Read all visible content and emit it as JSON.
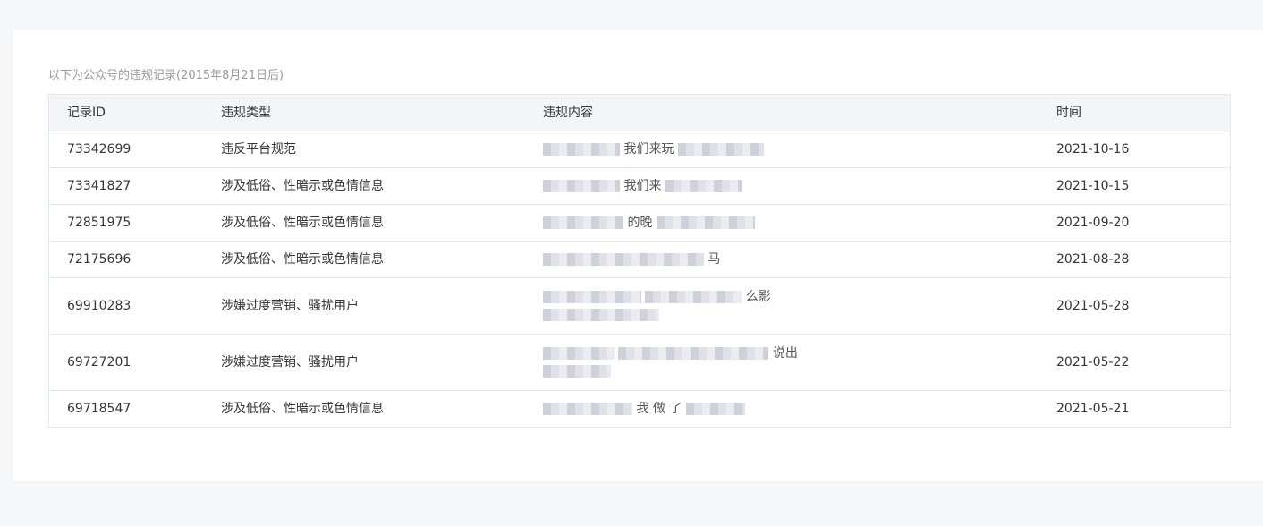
{
  "caption": "以下为公众号的违规记录(2015年8月21日后)",
  "headers": {
    "id": "记录ID",
    "type": "违规类型",
    "content": "违规内容",
    "time": "时间"
  },
  "rows": [
    {
      "id": "73342699",
      "type": "违反平台规范",
      "content": "我们来玩",
      "time": "2021-10-16"
    },
    {
      "id": "73341827",
      "type": "涉及低俗、性暗示或色情信息",
      "content": "我们来",
      "time": "2021-10-15"
    },
    {
      "id": "72851975",
      "type": "涉及低俗、性暗示或色情信息",
      "content": "的晚",
      "time": "2021-09-20"
    },
    {
      "id": "72175696",
      "type": "涉及低俗、性暗示或色情信息",
      "content": "马",
      "time": "2021-08-28"
    },
    {
      "id": "69910283",
      "type": "涉嫌过度营销、骚扰用户",
      "content": "么影",
      "time": "2021-05-28"
    },
    {
      "id": "69727201",
      "type": "涉嫌过度营销、骚扰用户",
      "content": "说出",
      "time": "2021-05-22"
    },
    {
      "id": "69718547",
      "type": "涉及低俗、性暗示或色情信息",
      "content": "我 做 了",
      "time": "2021-05-21"
    }
  ],
  "colors": {
    "page_bg": "#f6f7f9",
    "card_bg": "#ffffff",
    "header_bg": "#f4f5f9",
    "border": "#e4e8eb",
    "caption": "#9a9a9a"
  }
}
